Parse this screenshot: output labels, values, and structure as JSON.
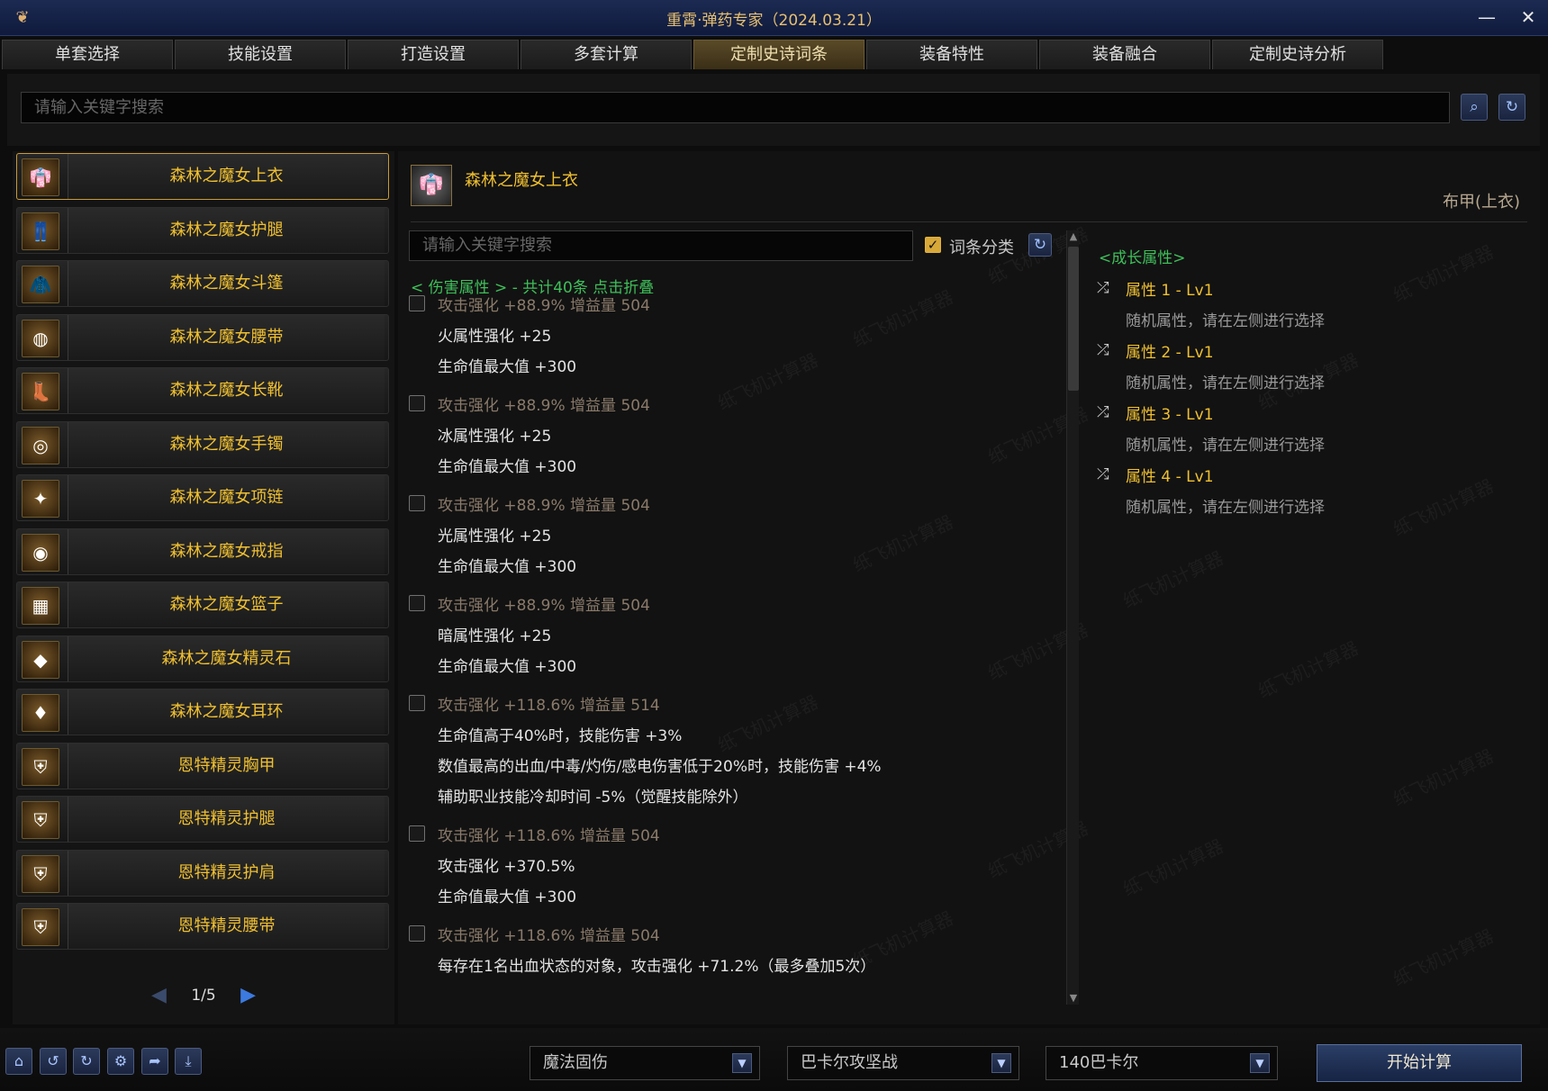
{
  "window": {
    "title": "重霄·弹药专家（2024.03.21）",
    "minimize_glyph": "—",
    "close_glyph": "✕"
  },
  "tabs": [
    {
      "label": "单套选择"
    },
    {
      "label": "技能设置"
    },
    {
      "label": "打造设置"
    },
    {
      "label": "多套计算"
    },
    {
      "label": "定制史诗词条",
      "active": true
    },
    {
      "label": "装备特性"
    },
    {
      "label": "装备融合"
    },
    {
      "label": "定制史诗分析"
    }
  ],
  "top_search": {
    "placeholder": "请输入关键字搜索"
  },
  "left_list": {
    "items": [
      {
        "label": "森林之魔女上衣",
        "icon": "coat-icon"
      },
      {
        "label": "森林之魔女护腿",
        "icon": "pants-icon"
      },
      {
        "label": "森林之魔女斗篷",
        "icon": "cloak-icon"
      },
      {
        "label": "森林之魔女腰带",
        "icon": "belt-icon"
      },
      {
        "label": "森林之魔女长靴",
        "icon": "boots-icon"
      },
      {
        "label": "森林之魔女手镯",
        "icon": "bracelet-icon"
      },
      {
        "label": "森林之魔女项链",
        "icon": "necklace-icon"
      },
      {
        "label": "森林之魔女戒指",
        "icon": "ring-icon"
      },
      {
        "label": "森林之魔女篮子",
        "icon": "basket-icon"
      },
      {
        "label": "森林之魔女精灵石",
        "icon": "spirit-stone-icon"
      },
      {
        "label": "森林之魔女耳环",
        "icon": "earring-icon"
      },
      {
        "label": "恩特精灵胸甲",
        "icon": "chest-armor-icon"
      },
      {
        "label": "恩特精灵护腿",
        "icon": "leg-armor-icon"
      },
      {
        "label": "恩特精灵护肩",
        "icon": "shoulder-armor-icon"
      },
      {
        "label": "恩特精灵腰带",
        "icon": "waist-armor-icon"
      }
    ],
    "page": "1/5"
  },
  "detail": {
    "name": "森林之魔女上衣",
    "type": "布甲(上衣)",
    "search_placeholder": "请输入关键字搜索",
    "category_label": "词条分类",
    "category_checked": true,
    "group_title": "< 伤害属性 > - 共计40条 点击折叠",
    "entries": [
      {
        "head": "攻击强化 +88.9%   增益量 504",
        "lines": [
          "火属性强化 +25",
          "生命值最大值 +300"
        ]
      },
      {
        "head": "攻击强化 +88.9%   增益量 504",
        "lines": [
          "冰属性强化 +25",
          "生命值最大值 +300"
        ]
      },
      {
        "head": "攻击强化 +88.9%   增益量 504",
        "lines": [
          "光属性强化 +25",
          "生命值最大值 +300"
        ]
      },
      {
        "head": "攻击强化 +88.9%   增益量 504",
        "lines": [
          "暗属性强化 +25",
          "生命值最大值 +300"
        ]
      },
      {
        "head": "攻击强化 +118.6%   增益量 514",
        "lines": [
          "生命值高于40%时，技能伤害 +3%",
          "数值最高的出血/中毒/灼伤/感电伤害低于20%时，技能伤害 +4%",
          "辅助职业技能冷却时间 -5%（觉醒技能除外）"
        ]
      },
      {
        "head": "攻击强化 +118.6%   增益量 504",
        "lines": [
          "攻击强化 +370.5%",
          "生命值最大值 +300"
        ]
      },
      {
        "head": "攻击强化 +118.6%   增益量 504",
        "lines": [
          "每存在1名出血状态的对象，攻击强化 +71.2%（最多叠加5次）"
        ]
      }
    ],
    "growth": {
      "title": "<成长属性>",
      "attrs": [
        {
          "name": "属性 1 - Lv1",
          "hint": "随机属性，请在左侧进行选择"
        },
        {
          "name": "属性 2 - Lv1",
          "hint": "随机属性，请在左侧进行选择"
        },
        {
          "name": "属性 3 - Lv1",
          "hint": "随机属性，请在左侧进行选择"
        },
        {
          "name": "属性 4 - Lv1",
          "hint": "随机属性，请在左侧进行选择"
        }
      ]
    },
    "watermark": "纸飞机计算器"
  },
  "bottom": {
    "dropdown1": "魔法固伤",
    "dropdown2": "巴卡尔攻坚战",
    "dropdown3": "140巴卡尔",
    "start_label": "开始计算"
  },
  "colors": {
    "accent_gold": "#f0c030",
    "accent_green": "#3fbf5a",
    "button_blue": "#2b3e66"
  }
}
